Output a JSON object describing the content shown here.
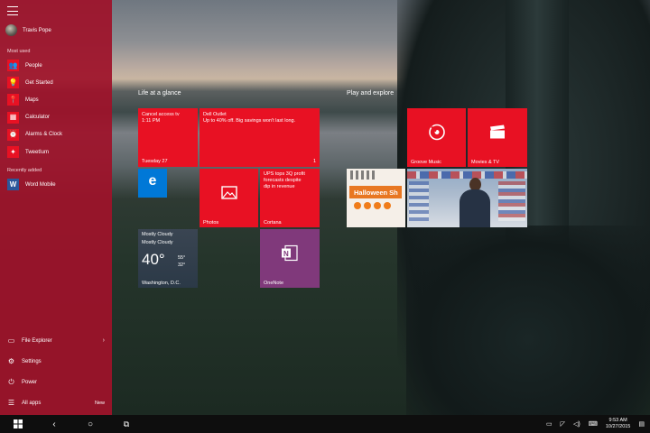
{
  "start_menu": {
    "user": {
      "name": "Travis Pope"
    },
    "most_used_label": "Most used",
    "most_used": [
      {
        "label": "People",
        "icon": "people-icon",
        "glyph": "👥"
      },
      {
        "label": "Get Started",
        "icon": "lightbulb-icon",
        "glyph": "💡"
      },
      {
        "label": "Maps",
        "icon": "map-pin-icon",
        "glyph": "📍"
      },
      {
        "label": "Calculator",
        "icon": "calculator-icon",
        "glyph": "▦"
      },
      {
        "label": "Alarms & Clock",
        "icon": "alarm-clock-icon",
        "glyph": "⏰"
      },
      {
        "label": "TweetIum",
        "icon": "tweetium-icon",
        "glyph": "✦"
      }
    ],
    "recently_added_label": "Recently added",
    "recently_added": [
      {
        "label": "Word Mobile",
        "icon": "word-icon",
        "glyph": "W"
      }
    ],
    "bottom": {
      "file_explorer": "File Explorer",
      "settings": "Settings",
      "power": "Power",
      "all_apps": "All apps",
      "new_badge": "New"
    }
  },
  "tiles": {
    "group1_label": "Life at a glance",
    "group2_label": "Play and explore",
    "calendar": {
      "line1": "Cancel access tv",
      "line2": "1:11 PM",
      "date": "Tuesday 27"
    },
    "mail": {
      "line1": "Dell Outlet",
      "line2": "Up to 40% off. Big savings won't last long.",
      "count": "1"
    },
    "edge": {
      "name": "Microsoft Edge"
    },
    "photos": {
      "name": "Photos"
    },
    "cortana": {
      "line1": "UPS tops 3Q profit",
      "line2": "forecasts despite",
      "line3": "dip in revenue",
      "name": "Cortana"
    },
    "weather": {
      "cond1": "Mostly Cloudy",
      "cond2": "Mostly Cloudy",
      "temp": "40°",
      "hi": "55°",
      "lo": "32°",
      "city": "Washington, D.C."
    },
    "onenote": {
      "name": "OneNote"
    },
    "groove": {
      "name": "Groove Music"
    },
    "movies": {
      "name": "Movies & TV"
    },
    "halloween": {
      "text": "Halloween Sh"
    }
  },
  "taskbar": {
    "time": "9:53 AM",
    "date": "10/27/2015"
  },
  "colors": {
    "accent": "#e81123",
    "start_pane": "#9e122a",
    "onenote": "#80397b",
    "edge": "#0078d7"
  }
}
